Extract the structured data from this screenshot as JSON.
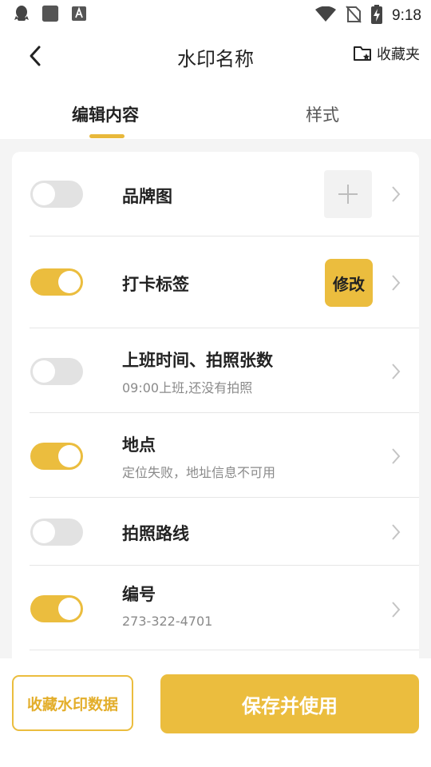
{
  "status_bar": {
    "time": "9:18",
    "left_icons": [
      "qq-icon",
      "app-square-icon",
      "keyboard-a-icon"
    ],
    "right_icons": [
      "wifi-icon",
      "no-sim-icon",
      "battery-charging-icon"
    ]
  },
  "header": {
    "title": "水印名称",
    "favorites_label": "收藏夹"
  },
  "tabs": [
    {
      "label": "编辑内容",
      "active": true
    },
    {
      "label": "样式",
      "active": false
    }
  ],
  "rows": [
    {
      "title": "品牌图",
      "subtitle": "",
      "enabled": false,
      "action": "add"
    },
    {
      "title": "打卡标签",
      "subtitle": "",
      "enabled": true,
      "action": "修改"
    },
    {
      "title": "上班时间、拍照张数",
      "subtitle": "09:00上班,还没有拍照",
      "enabled": false,
      "action": ""
    },
    {
      "title": "地点",
      "subtitle": "定位失败，地址信息不可用",
      "enabled": true,
      "action": ""
    },
    {
      "title": "拍照路线",
      "subtitle": "",
      "enabled": false,
      "action": ""
    },
    {
      "title": "编号",
      "subtitle": "273-322-4701",
      "enabled": true,
      "action": ""
    }
  ],
  "bottom": {
    "collect_label": "收藏水印数据",
    "save_label": "保存并使用"
  },
  "colors": {
    "accent": "#ebbd3e",
    "toggle_off": "#e2e2e2",
    "page_bg": "#f4f4f4"
  }
}
